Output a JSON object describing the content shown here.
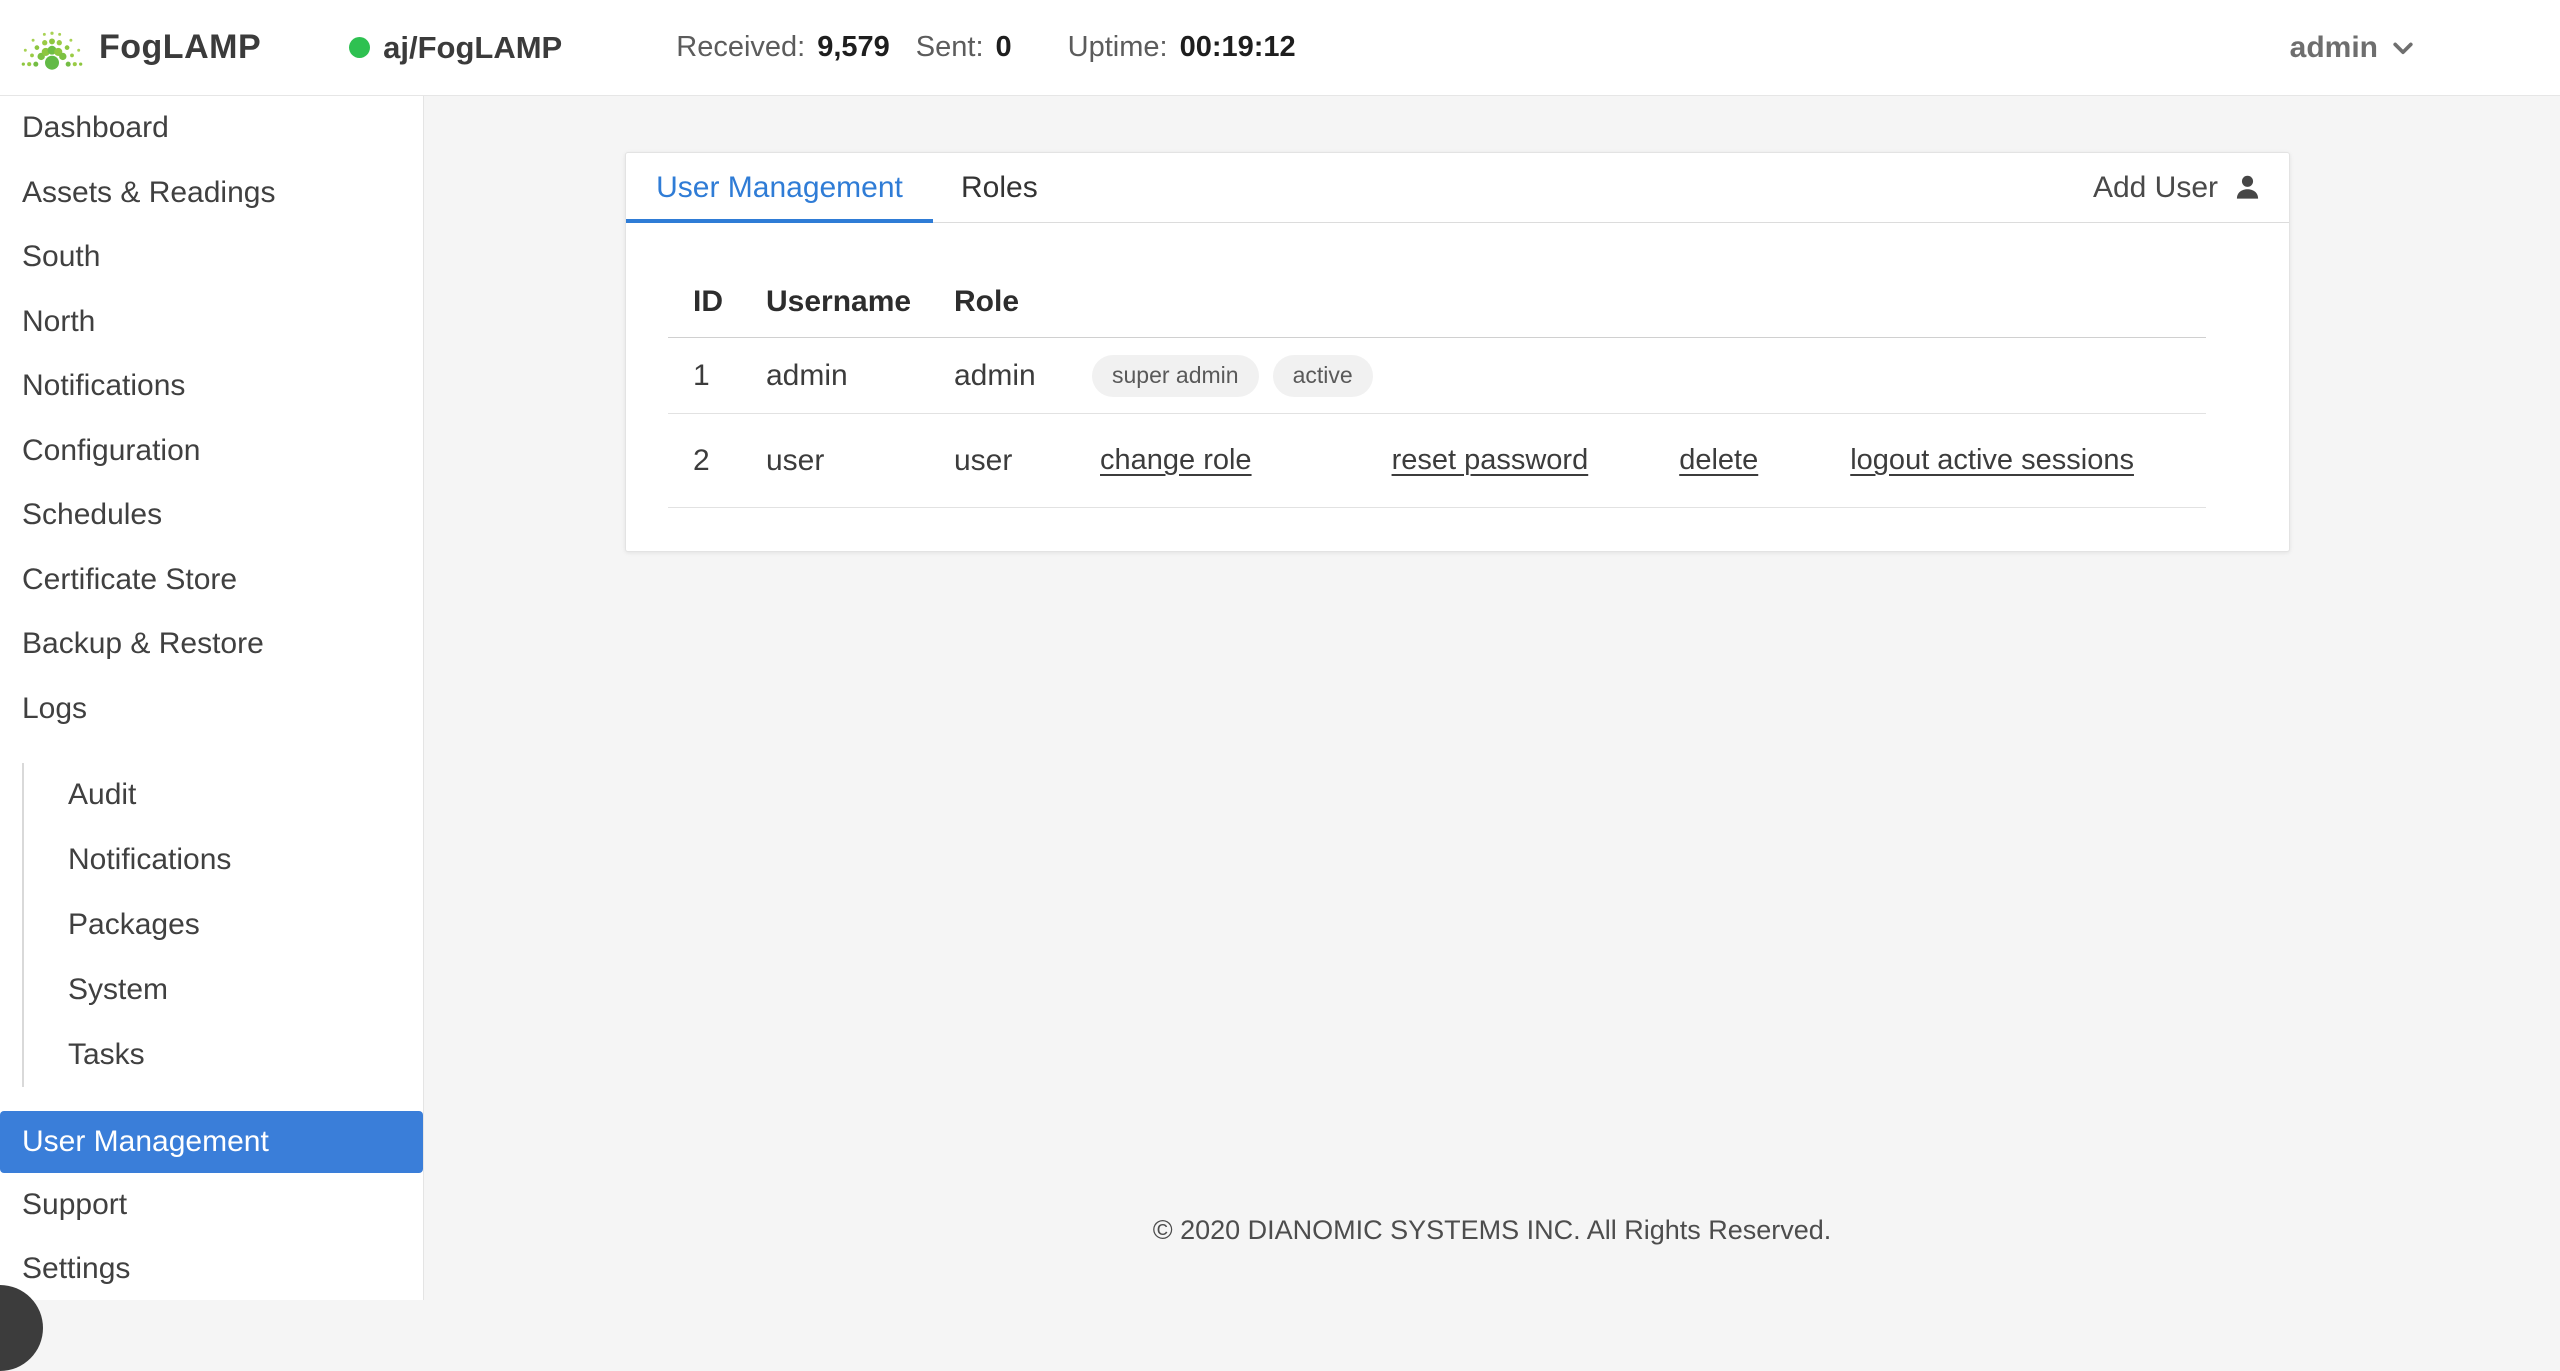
{
  "header": {
    "app_name": "FogLAMP",
    "service": {
      "name": "aj/FogLAMP",
      "status_color": "#2ec151"
    },
    "stats": [
      {
        "label": "Received:",
        "value": "9,579"
      },
      {
        "label": "Sent:",
        "value": "0"
      },
      {
        "label": "Uptime:",
        "value": "00:19:12"
      }
    ],
    "user_menu": {
      "label": "admin"
    }
  },
  "sidebar": {
    "items": [
      "Dashboard",
      "Assets & Readings",
      "South",
      "North",
      "Notifications",
      "Configuration",
      "Schedules",
      "Certificate Store",
      "Backup & Restore",
      "Logs"
    ],
    "logs_subitems": [
      "Audit",
      "Notifications",
      "Packages",
      "System",
      "Tasks"
    ],
    "active_item": "User Management",
    "bottom_items": [
      "Support",
      "Settings"
    ],
    "active_bg": "#3a7ed9"
  },
  "main": {
    "tabs": [
      {
        "label": "User Management",
        "active": true
      },
      {
        "label": "Roles",
        "active": false
      }
    ],
    "add_user_label": "Add User",
    "table": {
      "columns": [
        "ID",
        "Username",
        "Role"
      ],
      "rows": [
        {
          "id": "1",
          "username": "admin",
          "role": "admin",
          "badges": [
            "super admin",
            "active"
          ],
          "actions": []
        },
        {
          "id": "2",
          "username": "user",
          "role": "user",
          "badges": [],
          "actions": [
            "change role",
            "reset password",
            "delete",
            "logout active sessions"
          ]
        }
      ]
    },
    "footer": "© 2020 DIANOMIC SYSTEMS INC. All Rights Reserved."
  },
  "colors": {
    "accent_blue": "#3a7ed9",
    "tab_blue": "#2f7cd6",
    "status_green": "#2ec151",
    "badge_bg": "#f1f1f1",
    "main_bg": "#f5f5f5"
  }
}
